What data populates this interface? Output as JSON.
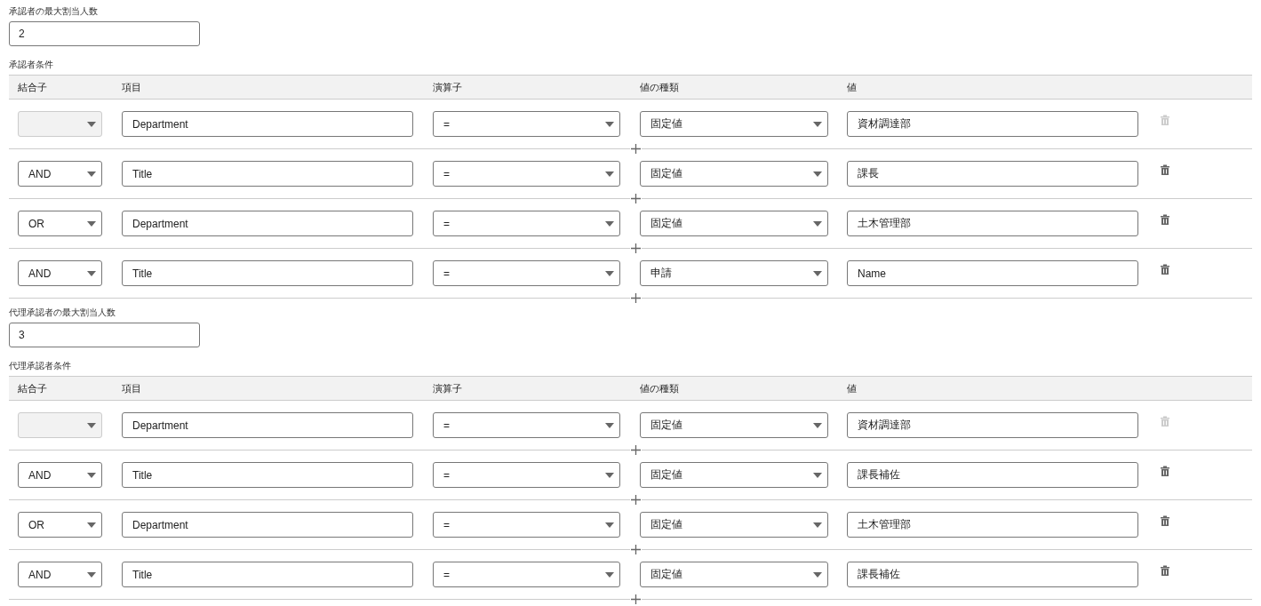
{
  "sections": [
    {
      "max_label": "承認者の最大割当人数",
      "max_value": "2",
      "conditions_label": "承認者条件",
      "columns": [
        "結合子",
        "項目",
        "演算子",
        "値の種類",
        "値"
      ],
      "rows": [
        {
          "connector_disabled": true,
          "field": "Department",
          "operator": "=",
          "value_type": "固定値",
          "value": "資材調達部",
          "delete_disabled": true
        },
        {
          "connector": "AND",
          "connector_disabled": false,
          "field": "Title",
          "operator": "=",
          "value_type": "固定値",
          "value": "課長",
          "delete_disabled": false
        },
        {
          "connector": "OR",
          "connector_disabled": false,
          "field": "Department",
          "operator": "=",
          "value_type": "固定値",
          "value": "土木管理部",
          "delete_disabled": false
        },
        {
          "connector": "AND",
          "connector_disabled": false,
          "field": "Title",
          "operator": "=",
          "value_type": "申請",
          "value": "Name",
          "delete_disabled": false
        }
      ]
    },
    {
      "max_label": "代理承認者の最大割当人数",
      "max_value": "3",
      "conditions_label": "代理承認者条件",
      "columns": [
        "結合子",
        "項目",
        "演算子",
        "値の種類",
        "値"
      ],
      "rows": [
        {
          "connector_disabled": true,
          "field": "Department",
          "operator": "=",
          "value_type": "固定値",
          "value": "資材調達部",
          "delete_disabled": true
        },
        {
          "connector": "AND",
          "connector_disabled": false,
          "field": "Title",
          "operator": "=",
          "value_type": "固定値",
          "value": "課長補佐",
          "delete_disabled": false
        },
        {
          "connector": "OR",
          "connector_disabled": false,
          "field": "Department",
          "operator": "=",
          "value_type": "固定値",
          "value": "土木管理部",
          "delete_disabled": false
        },
        {
          "connector": "AND",
          "connector_disabled": false,
          "field": "Title",
          "operator": "=",
          "value_type": "固定値",
          "value": "課長補佐",
          "delete_disabled": false
        }
      ]
    }
  ]
}
